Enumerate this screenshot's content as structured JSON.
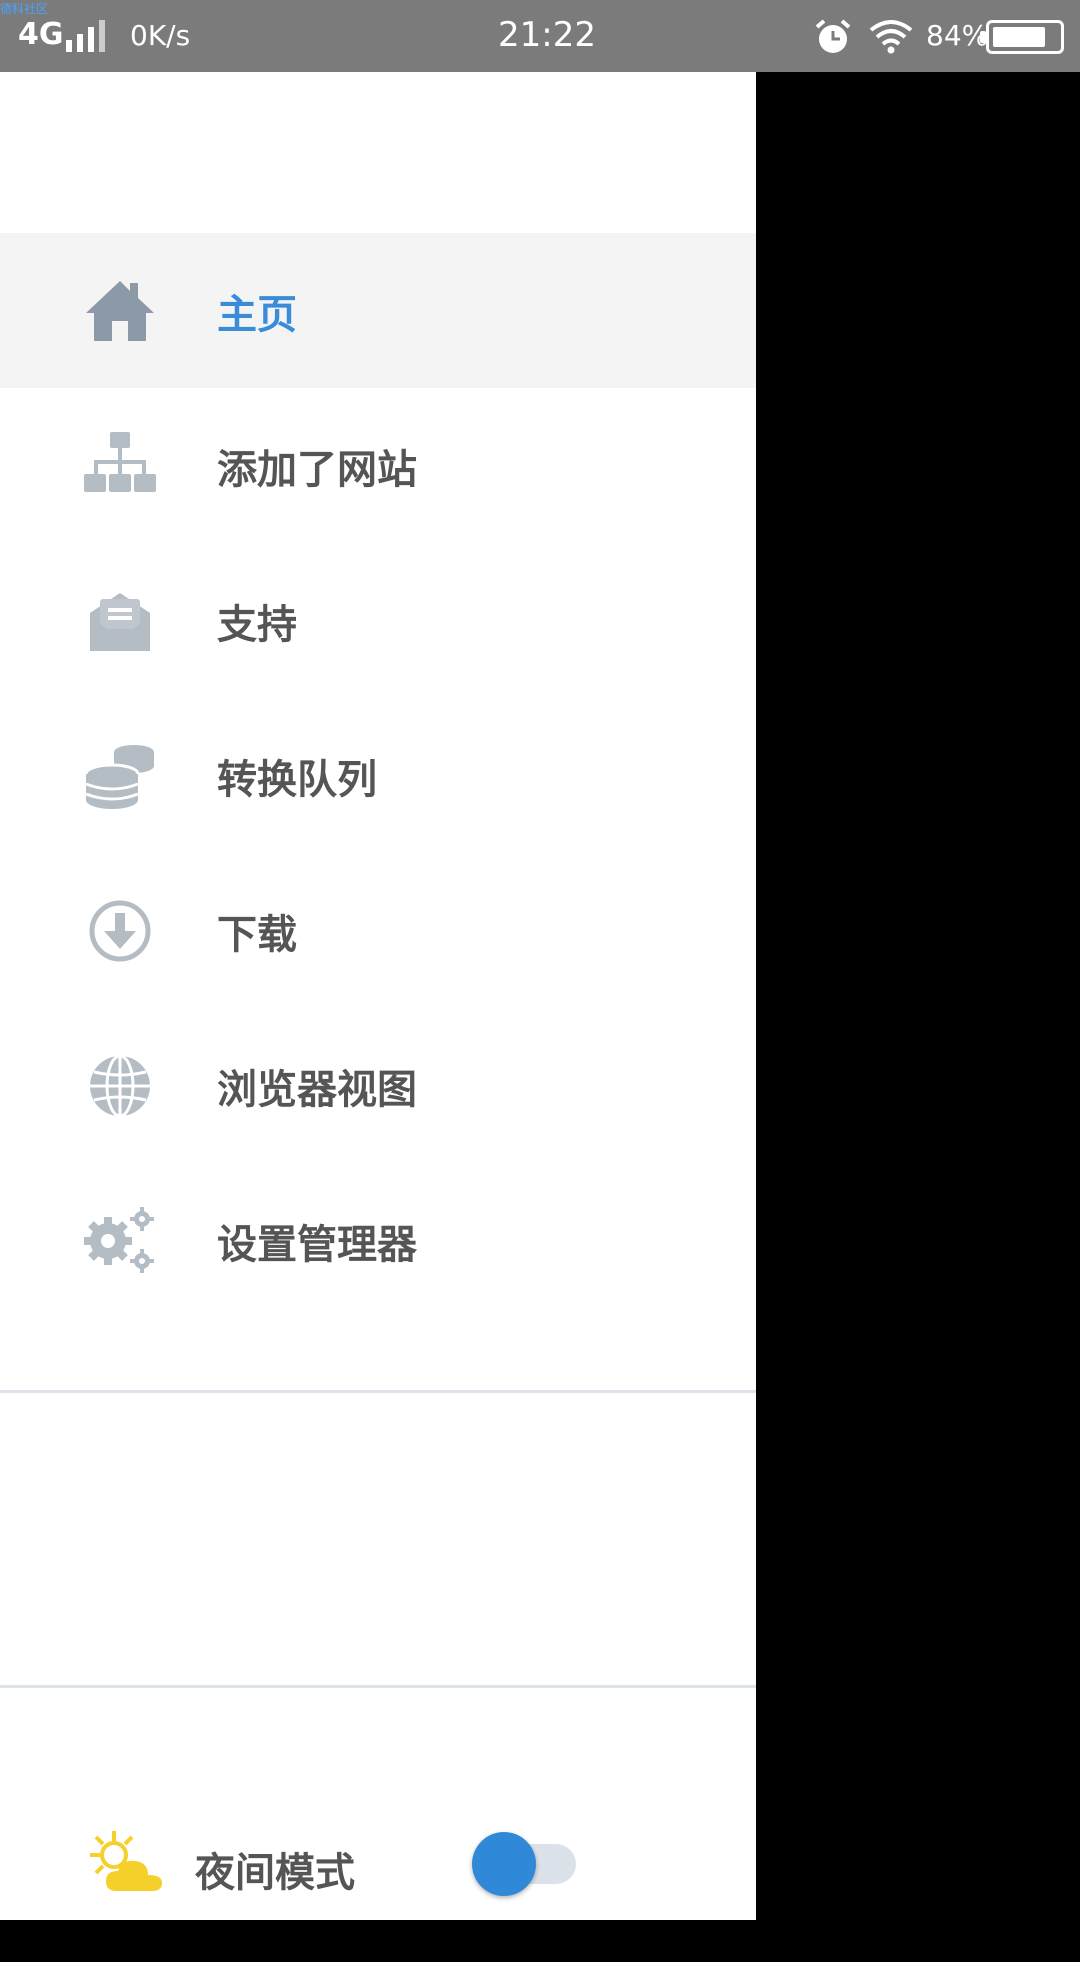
{
  "status_bar": {
    "corner_text": "德科社区",
    "network": "4G",
    "speed": "0K/s",
    "time": "21:22",
    "battery_percent": "84%",
    "battery_level": 0.84,
    "icons": [
      "signal-icon",
      "alarm-icon",
      "wifi-icon",
      "battery-icon"
    ]
  },
  "drawer": {
    "menu": [
      {
        "label": "主页",
        "icon": "home-icon",
        "active": true
      },
      {
        "label": "添加了网站",
        "icon": "sitemap-icon",
        "active": false
      },
      {
        "label": "支持",
        "icon": "envelope-open-icon",
        "active": false
      },
      {
        "label": "转换队列",
        "icon": "coins-icon",
        "active": false
      },
      {
        "label": "下载",
        "icon": "download-circle-icon",
        "active": false
      },
      {
        "label": "浏览器视图",
        "icon": "globe-icon",
        "active": false
      },
      {
        "label": "设置管理器",
        "icon": "gears-icon",
        "active": false
      }
    ],
    "night_mode": {
      "label": "夜间模式",
      "icon": "sun-cloud-icon",
      "enabled": false
    }
  },
  "colors": {
    "accent": "#3a8bd8",
    "toggle_knob": "#2f89d8",
    "icon_gray": "#b4bcc4",
    "text_dark": "#555555",
    "status_bar_bg": "#7b7b7b",
    "night_icon_yellow": "#f5cf2a"
  }
}
